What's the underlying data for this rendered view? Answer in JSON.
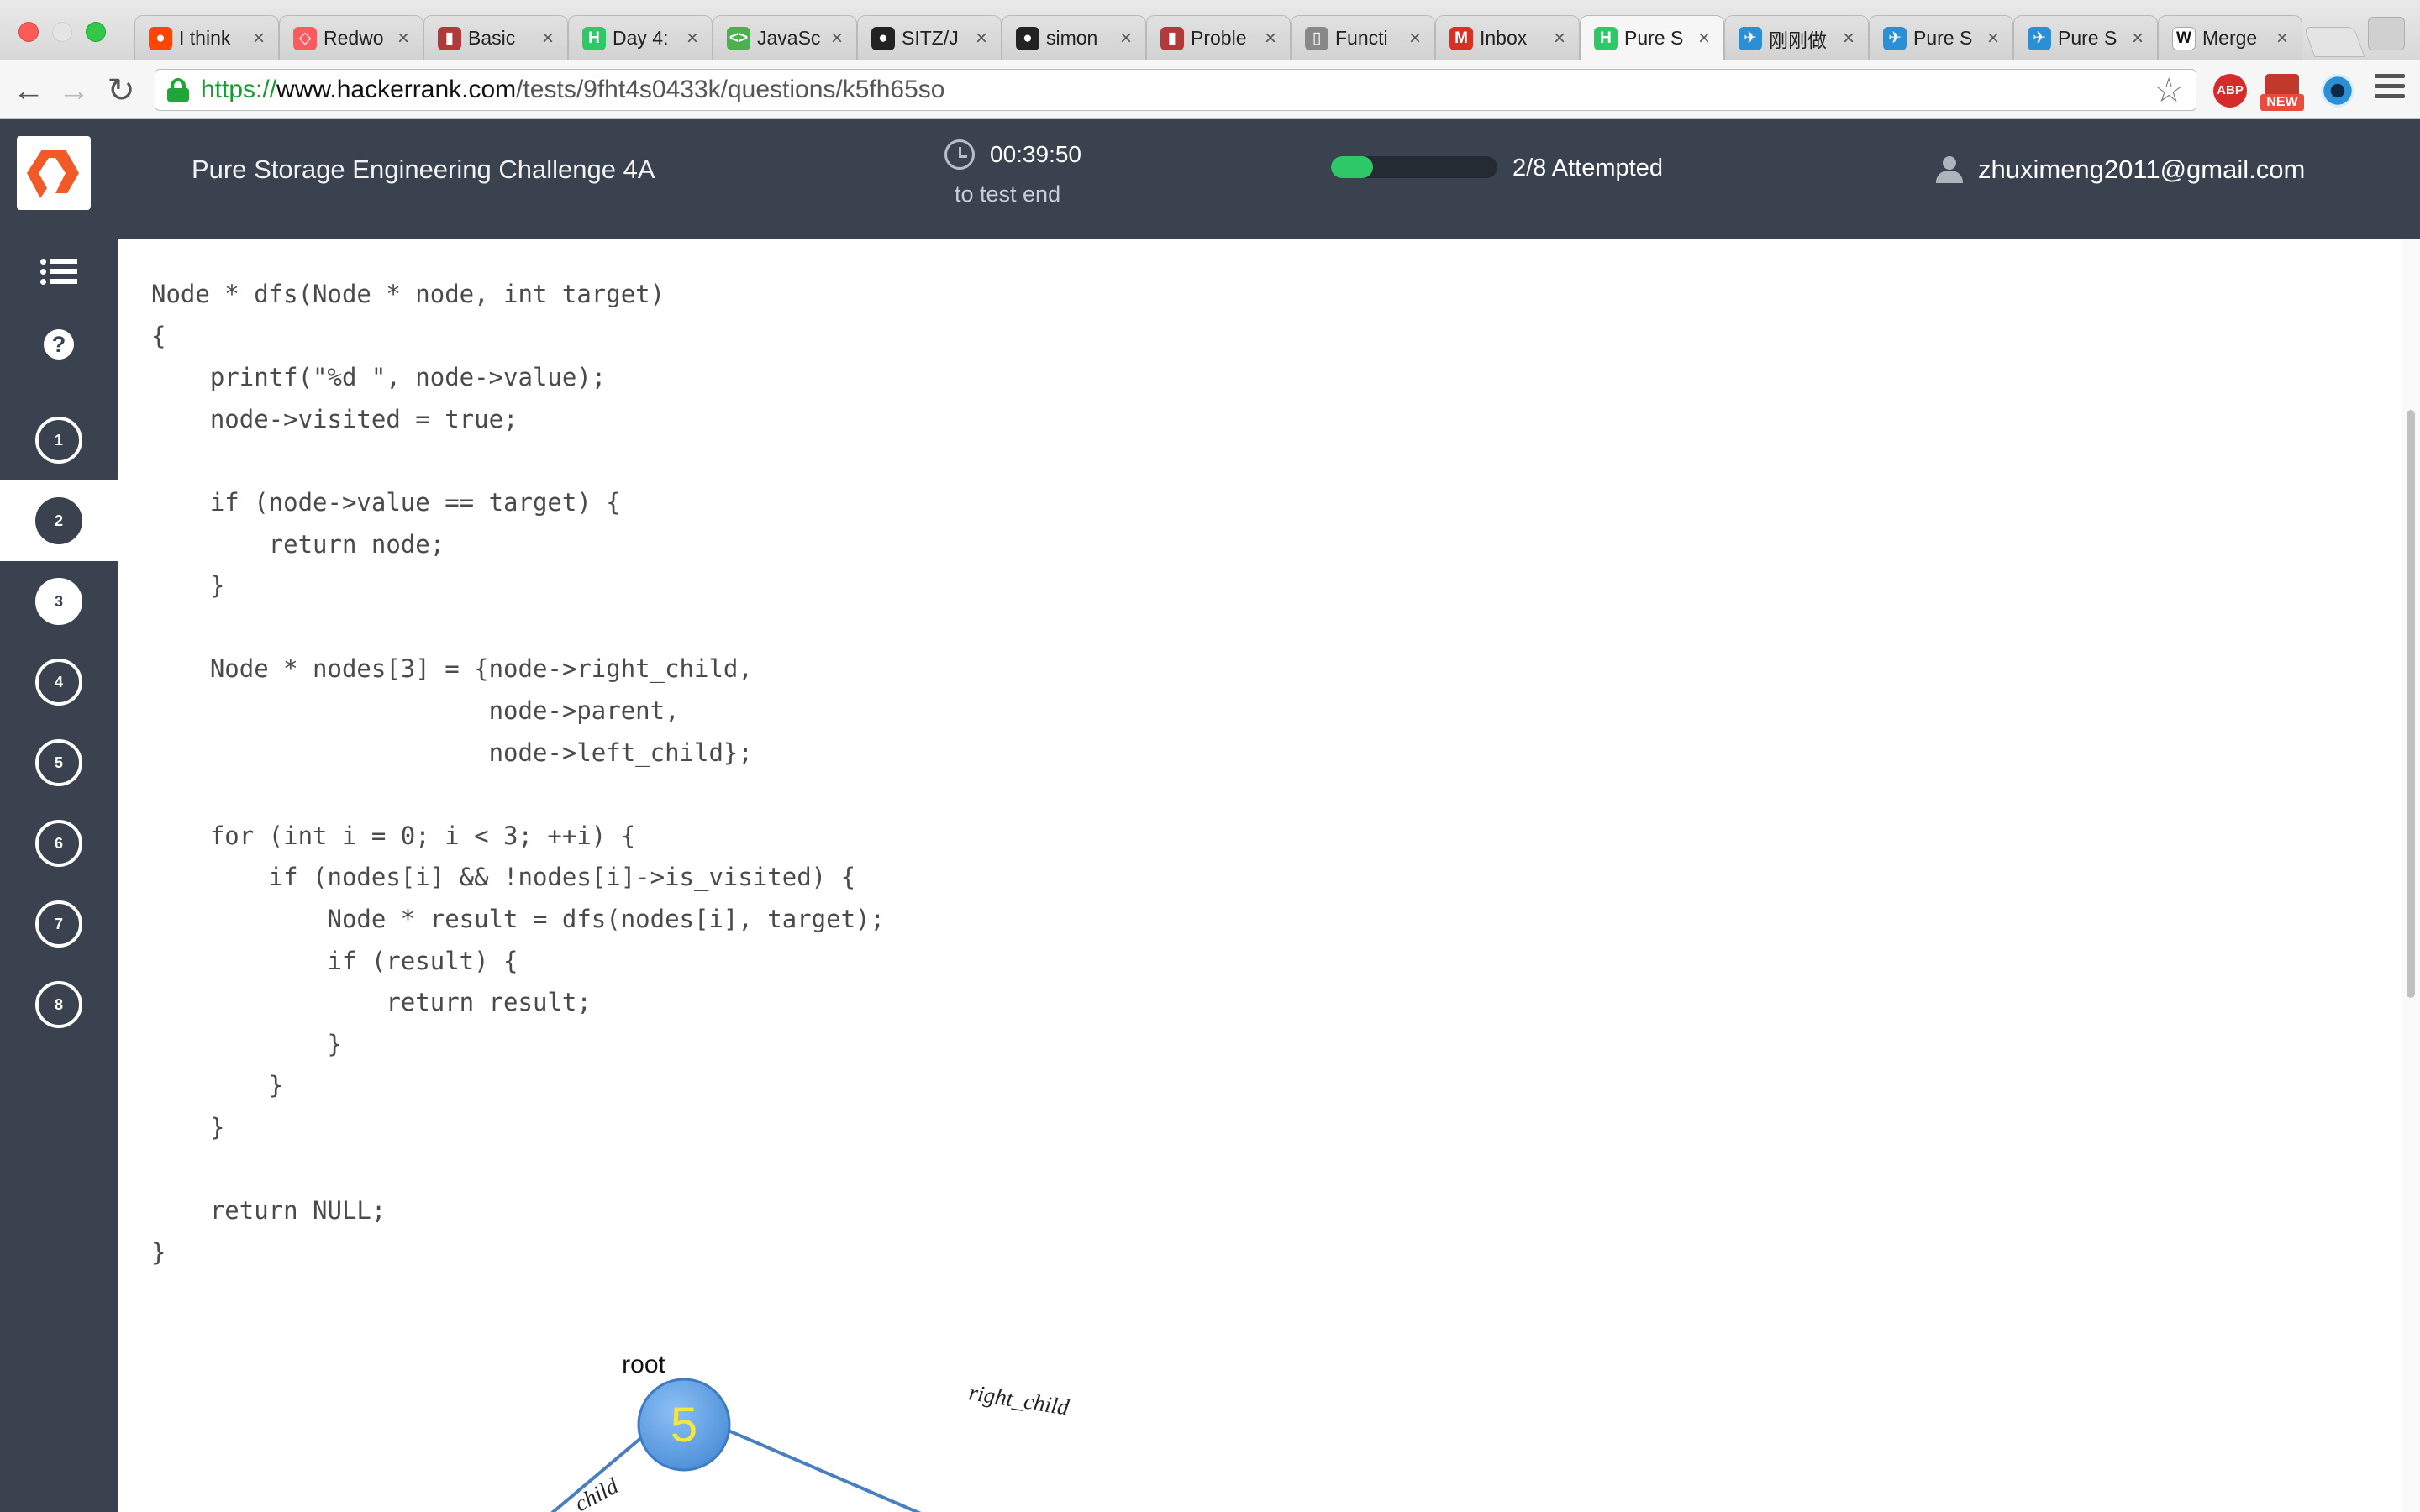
{
  "browser": {
    "tabs": [
      {
        "title": "I think",
        "icon": "reddit-icon",
        "color": "#ff4500",
        "glyph": "●"
      },
      {
        "title": "Redwo",
        "icon": "airbnb-icon",
        "color": "#ff5a5f",
        "glyph": "◇"
      },
      {
        "title": "Basic",
        "icon": "codecademy-icon",
        "color": "#b03a3a",
        "glyph": "▮"
      },
      {
        "title": "Day 4:",
        "icon": "hackerrank-icon",
        "color": "#2ec866",
        "glyph": "H"
      },
      {
        "title": "JavaSc",
        "icon": "code-icon",
        "color": "#4caf50",
        "glyph": "<>"
      },
      {
        "title": "SITZ/J",
        "icon": "github-icon",
        "color": "#222222",
        "glyph": "●"
      },
      {
        "title": "simon",
        "icon": "github-icon",
        "color": "#222222",
        "glyph": "●"
      },
      {
        "title": "Proble",
        "icon": "codecademy-icon",
        "color": "#b03a3a",
        "glyph": "▮"
      },
      {
        "title": "Functi",
        "icon": "document-icon",
        "color": "#888888",
        "glyph": "▯"
      },
      {
        "title": "Inbox",
        "icon": "gmail-icon",
        "color": "#d93025",
        "glyph": "M"
      },
      {
        "title": "Pure S",
        "icon": "hackerrank-icon",
        "color": "#2ec866",
        "glyph": "H",
        "active": true
      },
      {
        "title": "刚刚做",
        "icon": "bird-icon",
        "color": "#2b8fd6",
        "glyph": "✈"
      },
      {
        "title": "Pure S",
        "icon": "bird-icon",
        "color": "#2b8fd6",
        "glyph": "✈"
      },
      {
        "title": "Pure S",
        "icon": "bird-icon",
        "color": "#2b8fd6",
        "glyph": "✈"
      },
      {
        "title": "Merge",
        "icon": "wikipedia-icon",
        "color": "#ffffff",
        "glyph": "W"
      }
    ],
    "url": {
      "scheme": "https://",
      "host": "www.hackerrank.com",
      "path": "/tests/9fht4s0433k/questions/k5fh65so"
    },
    "extensions": {
      "abp": "ABP",
      "new_badge": "NEW"
    }
  },
  "header": {
    "test_title": "Pure Storage Engineering Challenge 4A",
    "timer": "00:39:50",
    "timer_caption": "to test end",
    "progress_fraction": 0.25,
    "progress_label": "2/8 Attempted",
    "user_email": "zhuximeng2011@gmail.com"
  },
  "sidebar": {
    "questions": [
      {
        "label": "1",
        "state": "unattempted"
      },
      {
        "label": "2",
        "state": "active"
      },
      {
        "label": "3",
        "state": "attempted"
      },
      {
        "label": "4",
        "state": "unattempted"
      },
      {
        "label": "5",
        "state": "unattempted"
      },
      {
        "label": "6",
        "state": "unattempted"
      },
      {
        "label": "7",
        "state": "unattempted"
      },
      {
        "label": "8",
        "state": "unattempted"
      }
    ]
  },
  "question": {
    "code_lines": [
      "Node * dfs(Node * node, int target)",
      "{",
      "    printf(\"%d \", node->value);",
      "    node->visited = true;",
      "",
      "    if (node->value == target) {",
      "        return node;",
      "    }",
      "",
      "    Node * nodes[3] = {node->right_child,",
      "                       node->parent,",
      "                       node->left_child};",
      "",
      "    for (int i = 0; i < 3; ++i) {",
      "        if (nodes[i] && !nodes[i]->is_visited) {",
      "            Node * result = dfs(nodes[i], target);",
      "            if (result) {",
      "                return result;",
      "            }",
      "        }",
      "    }",
      "",
      "    return NULL;",
      "}"
    ],
    "tree": {
      "root_label": "root",
      "root_value": "5",
      "left_edge_label": "child",
      "right_edge_label": "right_child"
    }
  },
  "colors": {
    "header_bg": "#39424e",
    "progress_green": "#2ec866",
    "brand_orange": "#f05a28",
    "node_blue": "#5d9be0",
    "node_value_yellow": "#f5e642"
  }
}
